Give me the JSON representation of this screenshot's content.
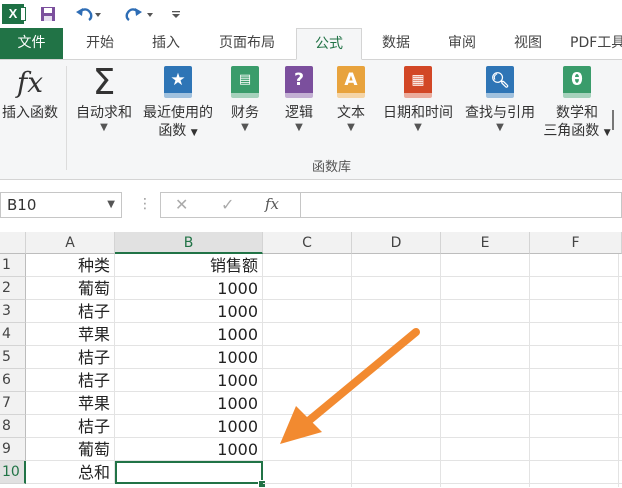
{
  "app": {
    "logo_text": "X"
  },
  "tabs": [
    "文件",
    "开始",
    "插入",
    "页面布局",
    "公式",
    "数据",
    "审阅",
    "视图",
    "PDF工具"
  ],
  "ribbon": {
    "buttons": [
      {
        "label": "插入函数"
      },
      {
        "label": "自动求和"
      },
      {
        "label": "最近使用的",
        "label2": "函数"
      },
      {
        "label": "财务"
      },
      {
        "label": "逻辑"
      },
      {
        "label": "文本"
      },
      {
        "label": "日期和时间"
      },
      {
        "label": "查找与引用"
      },
      {
        "label": "数学和",
        "label2": "三角函数"
      }
    ],
    "group_label": "函数库",
    "icon_colors": {
      "recent": "#2e75b6",
      "finance": "#3a9c6b",
      "logic": "#7b4f9d",
      "text": "#e8a33d",
      "datetime": "#d24726",
      "lookup": "#2e75b6",
      "math": "#3a9c6b"
    }
  },
  "formula_bar": {
    "name_box": "B10",
    "fx": "fx",
    "value": ""
  },
  "grid": {
    "columns": [
      "A",
      "B",
      "C",
      "D",
      "E",
      "F"
    ],
    "rows": [
      {
        "num": "1",
        "a": "种类",
        "b": "销售额"
      },
      {
        "num": "2",
        "a": "葡萄",
        "b": "1000"
      },
      {
        "num": "3",
        "a": "桔子",
        "b": "1000"
      },
      {
        "num": "4",
        "a": "苹果",
        "b": "1000"
      },
      {
        "num": "5",
        "a": "桔子",
        "b": "1000"
      },
      {
        "num": "6",
        "a": "桔子",
        "b": "1000"
      },
      {
        "num": "7",
        "a": "苹果",
        "b": "1000"
      },
      {
        "num": "8",
        "a": "桔子",
        "b": "1000"
      },
      {
        "num": "9",
        "a": "葡萄",
        "b": "1000"
      },
      {
        "num": "10",
        "a": "总和",
        "b": ""
      }
    ],
    "selected_cell": "B10"
  },
  "colors": {
    "accent": "#217346",
    "arrow": "#f28a30"
  }
}
